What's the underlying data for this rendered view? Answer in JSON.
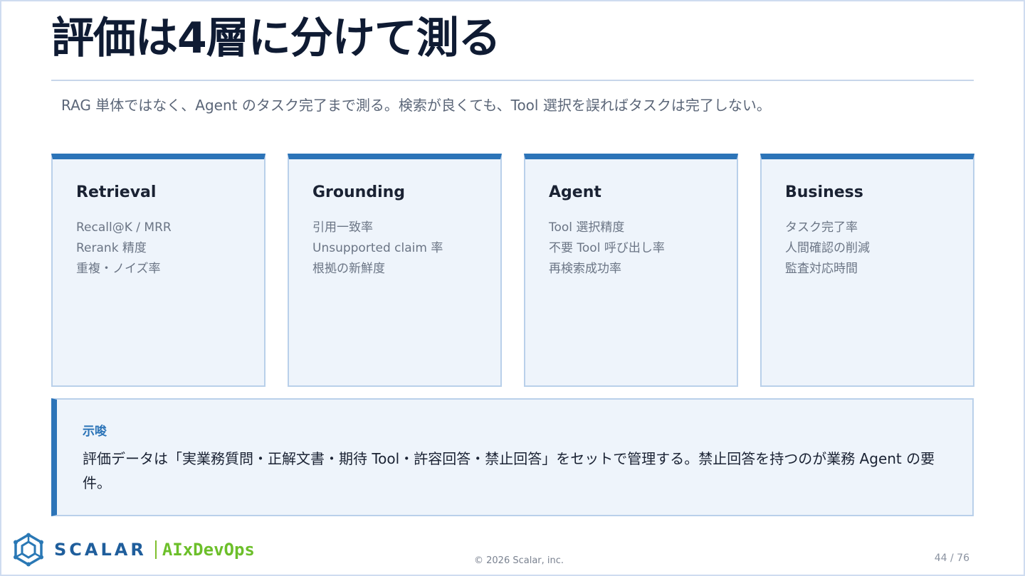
{
  "title": "評価は4層に分けて測る",
  "subtitle": "RAG 単体ではなく、Agent のタスク完了まで測る。検索が良くても、Tool 選択を誤ればタスクは完了しない。",
  "cards": [
    {
      "title": "Retrieval",
      "items": [
        "Recall@K / MRR",
        "Rerank 精度",
        "重複・ノイズ率"
      ]
    },
    {
      "title": "Grounding",
      "items": [
        "引用一致率",
        "Unsupported claim 率",
        "根拠の新鮮度"
      ]
    },
    {
      "title": "Agent",
      "items": [
        "Tool 選択精度",
        "不要 Tool 呼び出し率",
        "再検索成功率"
      ]
    },
    {
      "title": "Business",
      "items": [
        "タスク完了率",
        "人間確認の削減",
        "監査対応時間"
      ]
    }
  ],
  "insight": {
    "label": "示唆",
    "text": "評価データは「実業務質問・正解文書・期待 Tool・許容回答・禁止回答」をセットで管理する。禁止回答を持つのが業務 Agent の要件。"
  },
  "footer": {
    "brand": "SCALAR",
    "brand_sub": "AIxDevOps",
    "copyright": "© 2026 Scalar, inc.",
    "page": "44 / 76"
  },
  "colors": {
    "accent": "#2c74b8",
    "card_bg": "#eef4fb",
    "brand_green": "#6cbf2a"
  },
  "icons": {
    "logo": "scalar-hexagon-logo-icon"
  }
}
